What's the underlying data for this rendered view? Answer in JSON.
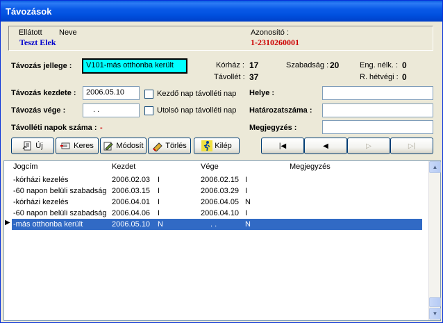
{
  "window": {
    "title": "Távozások"
  },
  "header": {
    "label_ellatott": "Ellátott",
    "label_neve": "Neve",
    "name": "Teszt Elek",
    "label_azonosito": "Azonosító :",
    "azonosito": "1-2310260001"
  },
  "form": {
    "jellege_label": "Távozás jellege :",
    "jellege_value": "V101-más otthonba került",
    "kezdete_label": "Távozás kezdete :",
    "kezdete_value": "2006.05.10",
    "vege_label": "Távozás vége :",
    "vege_value": " .  .",
    "napok_label": "Távolléti napok száma :",
    "napok_value": "-",
    "kezdo_check": "Kezdő nap távolléti nap",
    "utolso_check": "Utolsó nap távolléti nap",
    "helye_label": "Helye :",
    "hatarozat_label": "Határozatszáma :",
    "megjegyzes_label": "Megjegyzés :"
  },
  "stats": {
    "korhaz_label": "Kórház :",
    "korhaz": "17",
    "tavollet_label": "Távollét :",
    "tavollet": "37",
    "szabadsag_label": "Szabadság :",
    "szabadsag": "20",
    "eng_label": "Eng. nélk. :",
    "eng": "0",
    "hetvegi_label": "R. hétvégi :",
    "hetvegi": "0"
  },
  "toolbar": {
    "uj": "Új",
    "keres": "Keres",
    "modosit": "Módosít",
    "torles": "Törlés",
    "kilep": "Kilép"
  },
  "nav": {
    "first": "|◀",
    "prev": "◀",
    "next": "▷",
    "last": "▷|"
  },
  "grid": {
    "columns": [
      "Jogcím",
      "Kezdet",
      "Vége",
      "Megjegyzés"
    ],
    "rows": [
      [
        "-kórházi kezelés",
        "2006.02.03",
        "I",
        "2006.02.15",
        "I"
      ],
      [
        "-60 napon belüli szabadság",
        "2006.03.15",
        "I",
        "2006.03.29",
        "I"
      ],
      [
        "-kórházi kezelés",
        "2006.04.01",
        "I",
        "2006.04.05",
        "N"
      ],
      [
        "-60 napon belüli szabadság",
        "2006.04.06",
        "I",
        "2006.04.10",
        "I"
      ],
      [
        "-más otthonba került",
        "2006.05.10",
        "N",
        " .  .",
        "N"
      ]
    ],
    "row_pointer": "▶"
  },
  "colors": {
    "title_blue": "#0054e3",
    "selection": "#316ac5",
    "highlight_input": "#00ffff",
    "name_blue": "#0000cc",
    "id_red": "#cc0000"
  }
}
